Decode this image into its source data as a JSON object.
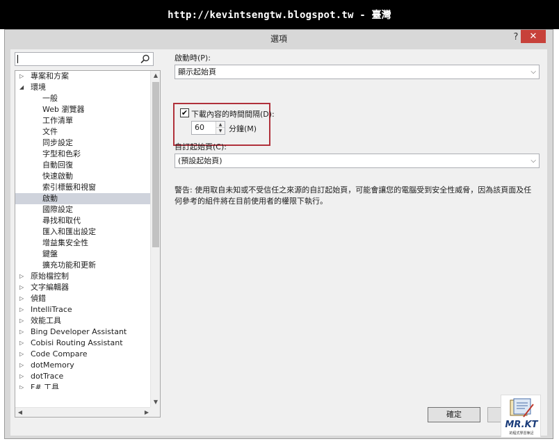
{
  "banner": {
    "text": "http://kevintsengtw.blogspot.tw - 臺灣"
  },
  "window": {
    "title": "選項",
    "help_glyph": "?",
    "close_glyph": "✕"
  },
  "search": {
    "value": "",
    "icon": "search-icon"
  },
  "tree": {
    "items": [
      {
        "label": "專案和方案",
        "expander": "▷",
        "level": 0
      },
      {
        "label": "環境",
        "expander": "◢",
        "level": 0
      },
      {
        "label": "一般",
        "expander": "",
        "level": 1
      },
      {
        "label": "Web 瀏覽器",
        "expander": "",
        "level": 1
      },
      {
        "label": "工作清單",
        "expander": "",
        "level": 1
      },
      {
        "label": "文件",
        "expander": "",
        "level": 1
      },
      {
        "label": "同步設定",
        "expander": "",
        "level": 1
      },
      {
        "label": "字型和色彩",
        "expander": "",
        "level": 1
      },
      {
        "label": "自動回復",
        "expander": "",
        "level": 1
      },
      {
        "label": "快速啟動",
        "expander": "",
        "level": 1
      },
      {
        "label": "索引標籤和視窗",
        "expander": "",
        "level": 1
      },
      {
        "label": "啟動",
        "expander": "",
        "level": 1,
        "selected": true
      },
      {
        "label": "國際設定",
        "expander": "",
        "level": 1
      },
      {
        "label": "尋找和取代",
        "expander": "",
        "level": 1
      },
      {
        "label": "匯入和匯出設定",
        "expander": "",
        "level": 1
      },
      {
        "label": "增益集安全性",
        "expander": "",
        "level": 1
      },
      {
        "label": "鍵盤",
        "expander": "",
        "level": 1
      },
      {
        "label": "擴充功能和更新",
        "expander": "",
        "level": 1
      },
      {
        "label": "原始檔控制",
        "expander": "▷",
        "level": 0
      },
      {
        "label": "文字編輯器",
        "expander": "▷",
        "level": 0
      },
      {
        "label": "偵錯",
        "expander": "▷",
        "level": 0
      },
      {
        "label": "IntelliTrace",
        "expander": "▷",
        "level": 0
      },
      {
        "label": "效能工具",
        "expander": "▷",
        "level": 0
      },
      {
        "label": "Bing Developer Assistant",
        "expander": "▷",
        "level": 0
      },
      {
        "label": "Cobisi Routing Assistant",
        "expander": "▷",
        "level": 0
      },
      {
        "label": "Code Compare",
        "expander": "▷",
        "level": 0
      },
      {
        "label": "dotMemory",
        "expander": "▷",
        "level": 0
      },
      {
        "label": "dotTrace",
        "expander": "▷",
        "level": 0
      },
      {
        "label": "F# 工具",
        "expander": "▷",
        "level": 0,
        "partial": true
      }
    ],
    "scroll_up": "▲",
    "scroll_down": "▼",
    "scroll_left": "◀",
    "scroll_right": "▶"
  },
  "settings": {
    "startup_label": "啟動時(P):",
    "startup_value": "顯示起始頁",
    "download_checkbox_checked": true,
    "download_checkbox_glyph": "✔",
    "download_label": "下載內容的時間間隔(D):",
    "interval_value": "60",
    "minutes_label": "分鐘(M)",
    "custom_start_label": "自訂起始頁(C):",
    "custom_start_value": "(預設起始頁)",
    "combo_chevron": "⌵",
    "warning": "警告: 使用取自未知或不受信任之來源的自訂起始頁，可能會讓您的電腦受到安全性威脅，因為該頁面及任何參考的組件將在目前使用者的權限下執行。"
  },
  "footer": {
    "ok_label": "確定"
  },
  "logo": {
    "text": "MR.KT",
    "caption": "的程式學習筆記"
  },
  "colors": {
    "highlight": "#b0303a",
    "close": "#c7413a",
    "selected_row": "#cfd3dc"
  }
}
